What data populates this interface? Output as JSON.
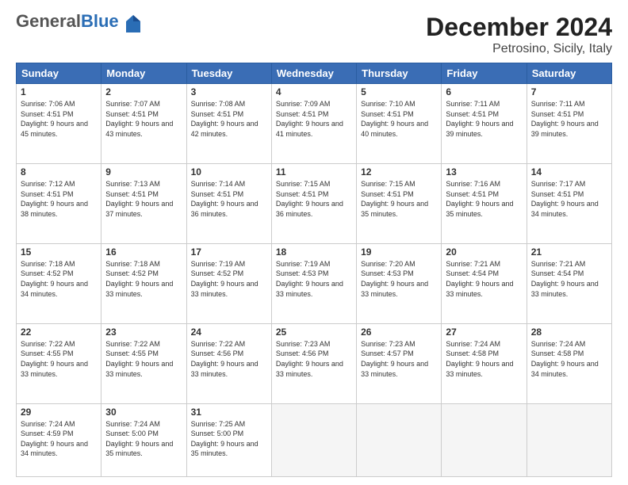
{
  "logo": {
    "general": "General",
    "blue": "Blue"
  },
  "header": {
    "month": "December 2024",
    "location": "Petrosino, Sicily, Italy"
  },
  "weekdays": [
    "Sunday",
    "Monday",
    "Tuesday",
    "Wednesday",
    "Thursday",
    "Friday",
    "Saturday"
  ],
  "weeks": [
    [
      {
        "day": "1",
        "sunrise": "7:06 AM",
        "sunset": "4:51 PM",
        "daylight": "9 hours and 45 minutes."
      },
      {
        "day": "2",
        "sunrise": "7:07 AM",
        "sunset": "4:51 PM",
        "daylight": "9 hours and 43 minutes."
      },
      {
        "day": "3",
        "sunrise": "7:08 AM",
        "sunset": "4:51 PM",
        "daylight": "9 hours and 42 minutes."
      },
      {
        "day": "4",
        "sunrise": "7:09 AM",
        "sunset": "4:51 PM",
        "daylight": "9 hours and 41 minutes."
      },
      {
        "day": "5",
        "sunrise": "7:10 AM",
        "sunset": "4:51 PM",
        "daylight": "9 hours and 40 minutes."
      },
      {
        "day": "6",
        "sunrise": "7:11 AM",
        "sunset": "4:51 PM",
        "daylight": "9 hours and 39 minutes."
      },
      {
        "day": "7",
        "sunrise": "7:11 AM",
        "sunset": "4:51 PM",
        "daylight": "9 hours and 39 minutes."
      }
    ],
    [
      {
        "day": "8",
        "sunrise": "7:12 AM",
        "sunset": "4:51 PM",
        "daylight": "9 hours and 38 minutes."
      },
      {
        "day": "9",
        "sunrise": "7:13 AM",
        "sunset": "4:51 PM",
        "daylight": "9 hours and 37 minutes."
      },
      {
        "day": "10",
        "sunrise": "7:14 AM",
        "sunset": "4:51 PM",
        "daylight": "9 hours and 36 minutes."
      },
      {
        "day": "11",
        "sunrise": "7:15 AM",
        "sunset": "4:51 PM",
        "daylight": "9 hours and 36 minutes."
      },
      {
        "day": "12",
        "sunrise": "7:15 AM",
        "sunset": "4:51 PM",
        "daylight": "9 hours and 35 minutes."
      },
      {
        "day": "13",
        "sunrise": "7:16 AM",
        "sunset": "4:51 PM",
        "daylight": "9 hours and 35 minutes."
      },
      {
        "day": "14",
        "sunrise": "7:17 AM",
        "sunset": "4:51 PM",
        "daylight": "9 hours and 34 minutes."
      }
    ],
    [
      {
        "day": "15",
        "sunrise": "7:18 AM",
        "sunset": "4:52 PM",
        "daylight": "9 hours and 34 minutes."
      },
      {
        "day": "16",
        "sunrise": "7:18 AM",
        "sunset": "4:52 PM",
        "daylight": "9 hours and 33 minutes."
      },
      {
        "day": "17",
        "sunrise": "7:19 AM",
        "sunset": "4:52 PM",
        "daylight": "9 hours and 33 minutes."
      },
      {
        "day": "18",
        "sunrise": "7:19 AM",
        "sunset": "4:53 PM",
        "daylight": "9 hours and 33 minutes."
      },
      {
        "day": "19",
        "sunrise": "7:20 AM",
        "sunset": "4:53 PM",
        "daylight": "9 hours and 33 minutes."
      },
      {
        "day": "20",
        "sunrise": "7:21 AM",
        "sunset": "4:54 PM",
        "daylight": "9 hours and 33 minutes."
      },
      {
        "day": "21",
        "sunrise": "7:21 AM",
        "sunset": "4:54 PM",
        "daylight": "9 hours and 33 minutes."
      }
    ],
    [
      {
        "day": "22",
        "sunrise": "7:22 AM",
        "sunset": "4:55 PM",
        "daylight": "9 hours and 33 minutes."
      },
      {
        "day": "23",
        "sunrise": "7:22 AM",
        "sunset": "4:55 PM",
        "daylight": "9 hours and 33 minutes."
      },
      {
        "day": "24",
        "sunrise": "7:22 AM",
        "sunset": "4:56 PM",
        "daylight": "9 hours and 33 minutes."
      },
      {
        "day": "25",
        "sunrise": "7:23 AM",
        "sunset": "4:56 PM",
        "daylight": "9 hours and 33 minutes."
      },
      {
        "day": "26",
        "sunrise": "7:23 AM",
        "sunset": "4:57 PM",
        "daylight": "9 hours and 33 minutes."
      },
      {
        "day": "27",
        "sunrise": "7:24 AM",
        "sunset": "4:58 PM",
        "daylight": "9 hours and 33 minutes."
      },
      {
        "day": "28",
        "sunrise": "7:24 AM",
        "sunset": "4:58 PM",
        "daylight": "9 hours and 34 minutes."
      }
    ],
    [
      {
        "day": "29",
        "sunrise": "7:24 AM",
        "sunset": "4:59 PM",
        "daylight": "9 hours and 34 minutes."
      },
      {
        "day": "30",
        "sunrise": "7:24 AM",
        "sunset": "5:00 PM",
        "daylight": "9 hours and 35 minutes."
      },
      {
        "day": "31",
        "sunrise": "7:25 AM",
        "sunset": "5:00 PM",
        "daylight": "9 hours and 35 minutes."
      },
      null,
      null,
      null,
      null
    ]
  ]
}
